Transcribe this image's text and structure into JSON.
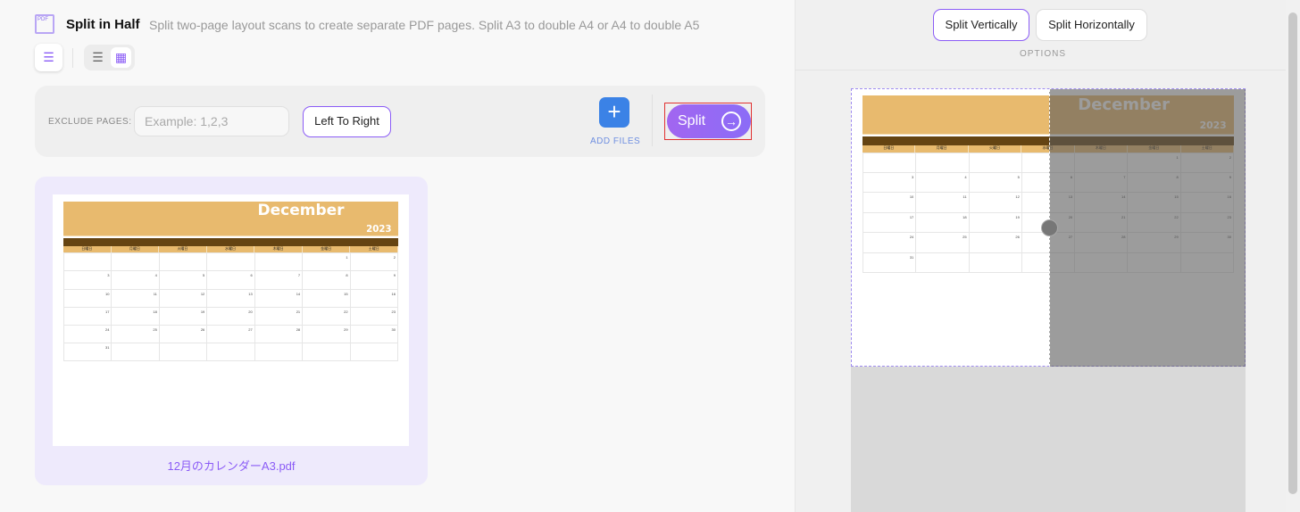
{
  "header": {
    "icon": "pdf-split-icon",
    "icon_text": "PDF",
    "title": "Split in Half",
    "description": "Split two-page layout scans to create separate PDF pages. Split A3 to double A4 or A4 to double A5"
  },
  "toolbar": {
    "sort_icon": "sort-az-icon",
    "list_icon": "list-view-icon",
    "grid_icon": "grid-view-icon",
    "active_view": "grid"
  },
  "controls": {
    "exclude_label": "EXCLUDE PAGES:",
    "exclude_value": "",
    "exclude_placeholder": "Example: 1,2,3",
    "order_label": "Left To Right",
    "add_files_label": "ADD FILES",
    "split_label": "Split"
  },
  "file": {
    "name": "12月のカレンダーA3.pdf"
  },
  "calendar": {
    "month": "December",
    "year": "2023",
    "weekdays": [
      "日曜日",
      "月曜日",
      "火曜日",
      "水曜日",
      "木曜日",
      "金曜日",
      "土曜日"
    ],
    "weeks": [
      [
        "",
        "",
        "",
        "",
        "",
        "1",
        "2"
      ],
      [
        "3",
        "4",
        "5",
        "6",
        "7",
        "8",
        "9"
      ],
      [
        "10",
        "11",
        "12",
        "13",
        "14",
        "15",
        "16"
      ],
      [
        "17",
        "18",
        "19",
        "20",
        "21",
        "22",
        "23"
      ],
      [
        "24",
        "25",
        "26",
        "27",
        "28",
        "29",
        "30"
      ],
      [
        "31",
        "",
        "",
        "",
        "",
        "",
        ""
      ]
    ]
  },
  "options": {
    "split_vertically": "Split Vertically",
    "split_horizontally": "Split Horizontally",
    "selected": "Split Vertically",
    "label": "OPTIONS"
  },
  "colors": {
    "accent": "#8b5cf6",
    "add_button": "#3b82e6",
    "calendar_header": "#e8ba6e",
    "calendar_bar": "#654412"
  }
}
